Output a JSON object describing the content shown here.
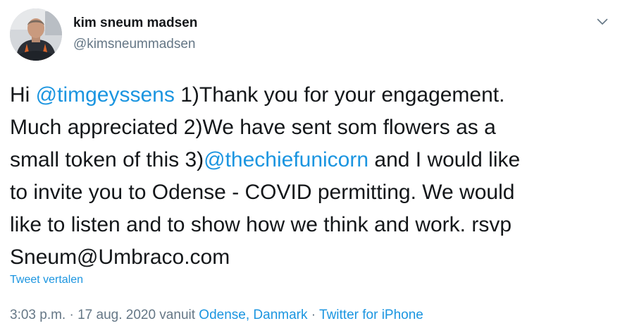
{
  "author": {
    "name": "kim sneum madsen",
    "handle": "@kimsneummadsen"
  },
  "tweet": {
    "line1": {
      "prefix": "Hi ",
      "mention": "@timgeyssens",
      "suffix": " 1)Thank you for your engagement."
    },
    "line2": "Much appreciated 2)We have sent som flowers as a",
    "line3": {
      "prefix": "small token of this 3)",
      "mention": "@thechiefunicorn",
      "suffix": " and I would like"
    },
    "line4": "to invite you to Odense - COVID permitting. We would",
    "line5": "like to listen and to show how we think and work. rsvp",
    "line6": "Sneum@Umbraco.com"
  },
  "translate_label": "Tweet vertalen",
  "meta": {
    "timestamp": "3:03 p.m. · 17 aug. 2020 vanuit ",
    "location": "Odense, Danmark",
    "separator": " · ",
    "source": "Twitter for iPhone"
  },
  "colors": {
    "link": "#1b95e0",
    "text": "#14171a",
    "muted": "#657786"
  },
  "icons": {
    "caret": "chevron-down-icon",
    "avatar": "profile-photo"
  }
}
